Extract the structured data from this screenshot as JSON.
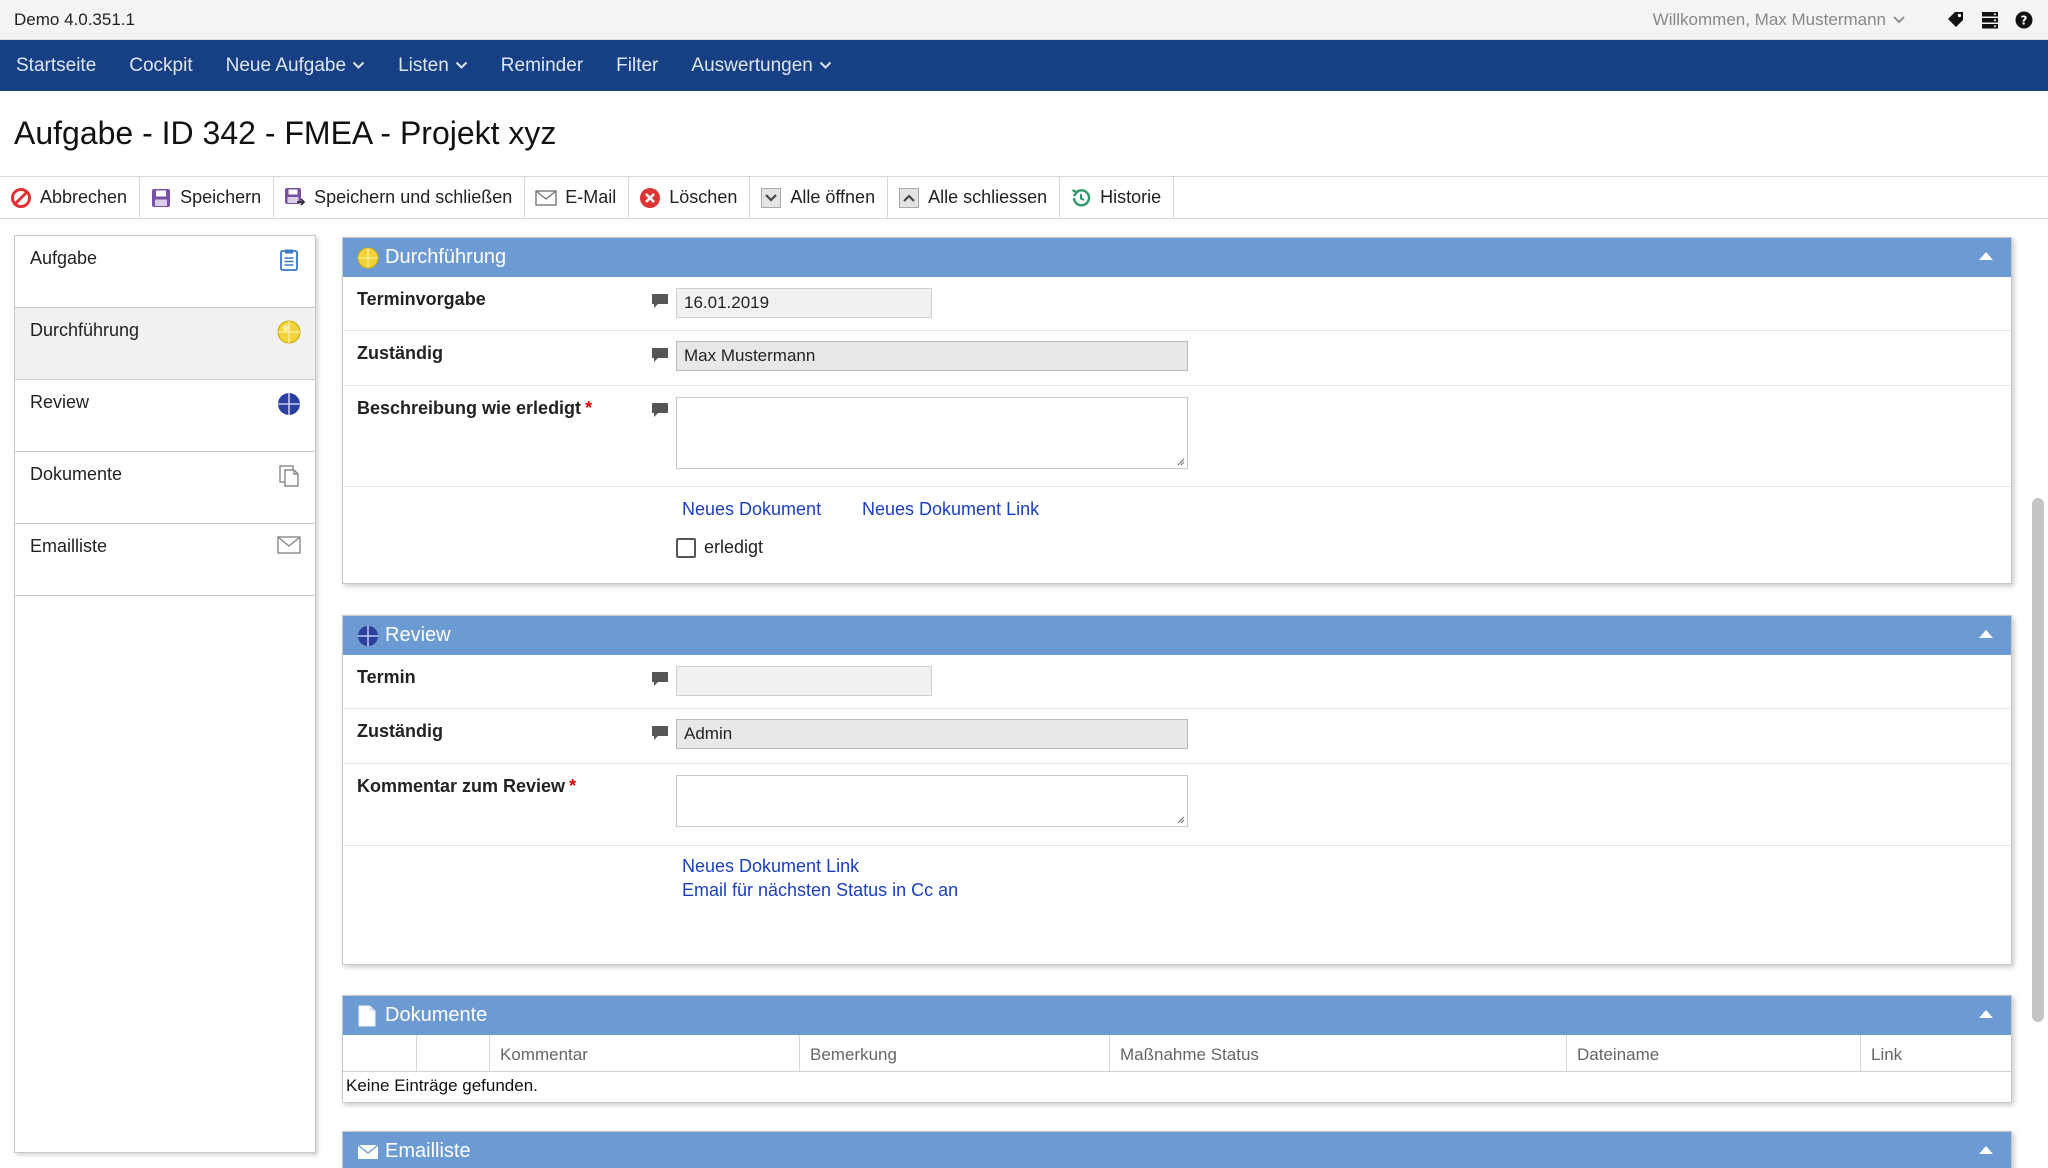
{
  "app": {
    "version": "Demo 4.0.351.1",
    "welcome": "Willkommen, Max Mustermann"
  },
  "nav": {
    "items": [
      "Startseite",
      "Cockpit",
      "Neue Aufgabe",
      "Listen",
      "Reminder",
      "Filter",
      "Auswertungen"
    ]
  },
  "page": {
    "title": "Aufgabe - ID 342 - FMEA - Projekt xyz"
  },
  "toolbar": {
    "cancel": "Abbrechen",
    "save": "Speichern",
    "save_close": "Speichern und schließen",
    "email": "E-Mail",
    "delete": "Löschen",
    "open_all": "Alle öffnen",
    "close_all": "Alle schliessen",
    "history": "Historie"
  },
  "sidebar": {
    "items": [
      "Aufgabe",
      "Durchführung",
      "Review",
      "Dokumente",
      "Emailliste"
    ]
  },
  "durchfuehrung": {
    "title": "Durchführung",
    "termin_label": "Terminvorgabe",
    "termin_value": "16.01.2019",
    "zustaendig_label": "Zuständig",
    "zustaendig_value": "Max Mustermann",
    "beschreibung_label": "Beschreibung wie erledigt",
    "required_mark": "*",
    "link_new_doc": "Neues Dokument",
    "link_new_doc_link": "Neues Dokument Link",
    "done_label": "erledigt"
  },
  "review": {
    "title": "Review",
    "termin_label": "Termin",
    "termin_value": "",
    "zustaendig_label": "Zuständig",
    "zustaendig_value": "Admin",
    "kommentar_label": "Kommentar zum Review",
    "required_mark": "*",
    "link_new_doc_link": "Neues Dokument Link",
    "link_email_cc": "Email für nächsten Status in Cc an"
  },
  "dokumente": {
    "title": "Dokumente",
    "columns": [
      "",
      "",
      "Kommentar",
      "Bemerkung",
      "Maßnahme Status",
      "Dateiname",
      "Link"
    ],
    "empty": "Keine Einträge gefunden."
  },
  "emailliste": {
    "title": "Emailliste"
  },
  "colors": {
    "nav_bg": "#163f84",
    "panel_header": "#6b9bd2",
    "link": "#1a3fbf",
    "required": "#dd0000"
  }
}
